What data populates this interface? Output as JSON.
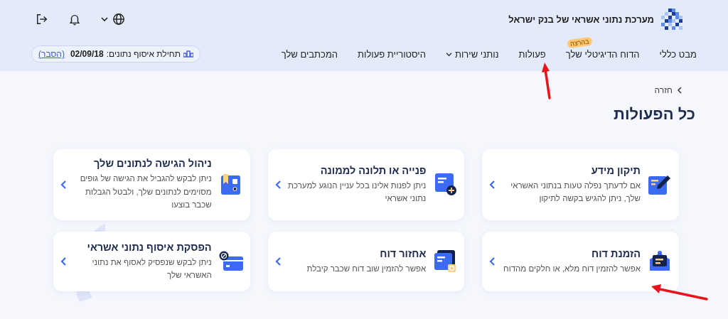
{
  "header": {
    "title": "מערכת נתוני אשראי של בנק ישראל"
  },
  "nav": {
    "items": [
      {
        "label": "מבט כללי",
        "dropdown": false
      },
      {
        "label": "הדוח הדיגיטלי שלך",
        "badge": "בהרצה",
        "dropdown": false
      },
      {
        "label": "פעולות",
        "dropdown": false
      },
      {
        "label": "נותני שירות",
        "dropdown": true
      },
      {
        "label": "היסטוריית פעולות",
        "dropdown": false
      },
      {
        "label": "המכתבים שלך",
        "dropdown": false
      }
    ]
  },
  "data_start": {
    "label": "תחילת איסוף נתונים:",
    "date": "02/09/18",
    "link": "(הסבר)"
  },
  "breadcrumb": {
    "back": "חזרה"
  },
  "page_title": "כל הפעולות",
  "cards": [
    {
      "kind": "edit",
      "title": "תיקון מידע",
      "description": "אם לדעתך נפלה טעות בנתוני האשראי שלך, ניתן להגיש בקשה לתיקון"
    },
    {
      "kind": "add",
      "title": "פנייה או תלונה לממונה",
      "description": "ניתן לפנות אלינו בכל עניין הנוגע למערכת נתוני אשראי"
    },
    {
      "kind": "access",
      "title": "ניהול הגישה לנתונים שלך",
      "description": "ניתן לבקש להגביל את הגישה של גופים מסוימים לנתונים שלך, ולבטל הגבלות שכבר בוצעו"
    },
    {
      "kind": "mail",
      "title": "הזמנת דוח",
      "description": "אפשר להזמין דוח מלא, או חלקים מהדוח"
    },
    {
      "kind": "refresh",
      "title": "אחזור דוח",
      "description": "אפשר להזמין שוב דוח שכבר קיבלת"
    },
    {
      "kind": "block",
      "title": "הפסקת איסוף נתוני אשראי",
      "description": "ניתן לבקש שנפסיק לאסוף את נתוני האשראי שלך"
    }
  ]
}
